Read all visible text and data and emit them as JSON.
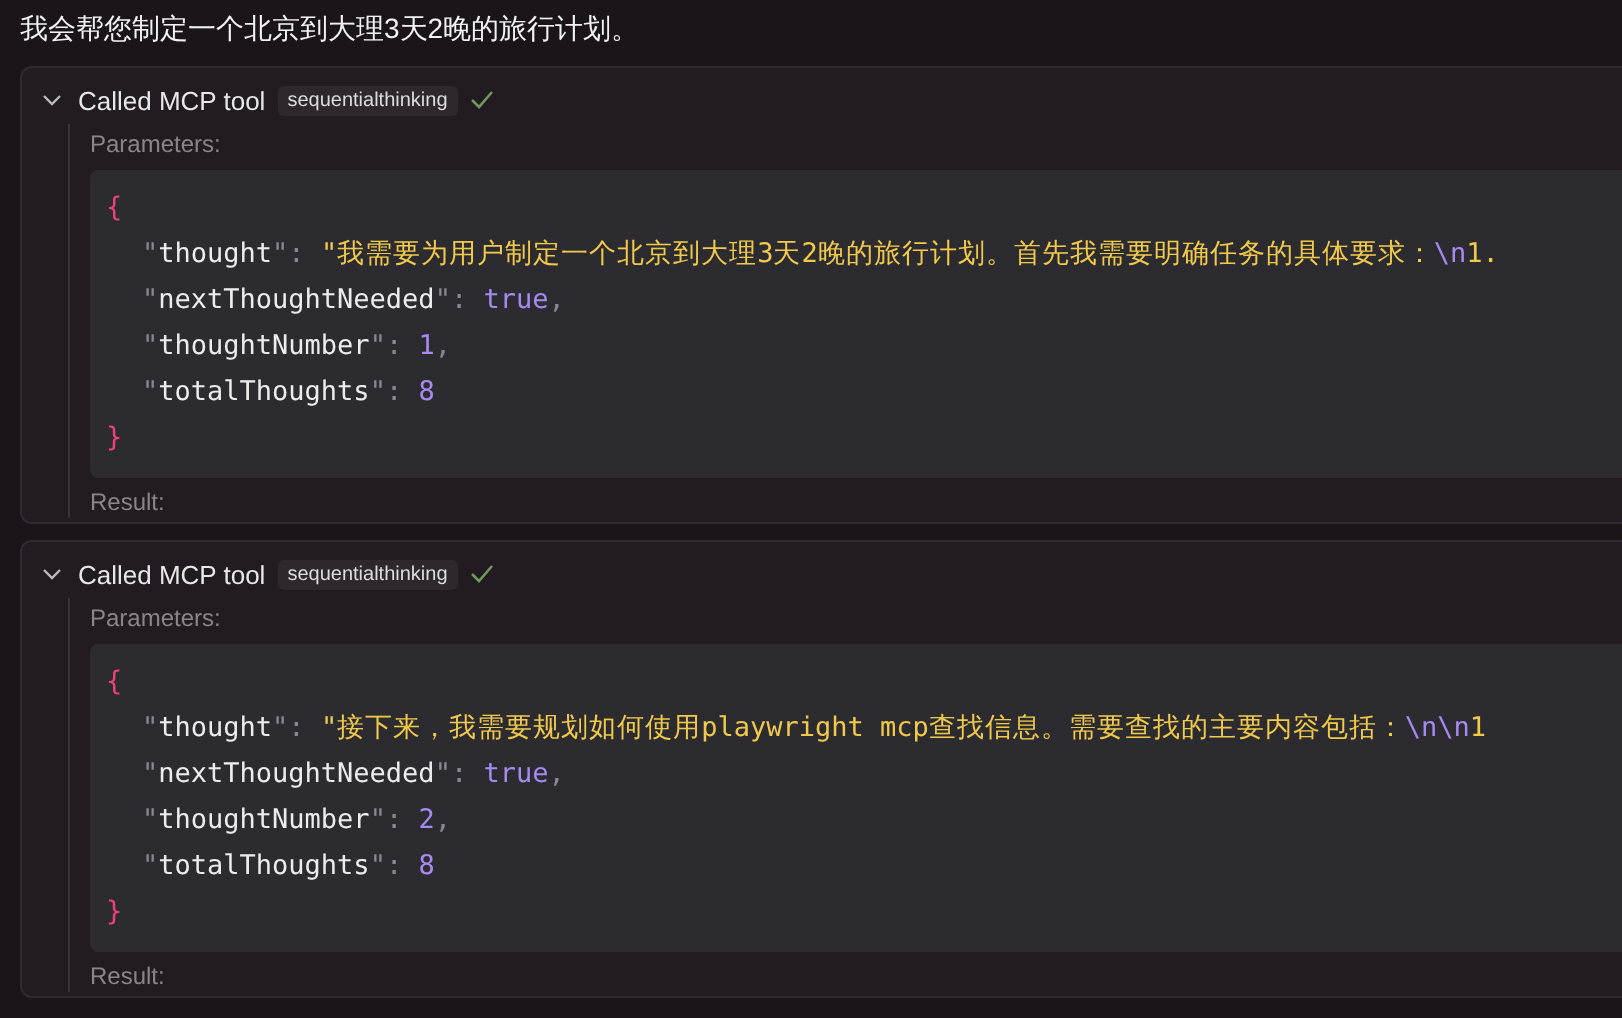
{
  "message": "我会帮您制定一个北京到大理3天2晚的旅行计划。",
  "tool_calls": [
    {
      "expanded": true,
      "label": "Called MCP tool",
      "tool": "sequentialthinking",
      "done": true,
      "params_label": "Parameters:",
      "result_label": "Result:",
      "code": [
        [
          {
            "kind": "brace",
            "text": "{"
          }
        ],
        [
          {
            "kind": "punct",
            "text": "\""
          },
          {
            "kind": "key",
            "text": "thought"
          },
          {
            "kind": "punct",
            "text": "\": "
          },
          {
            "kind": "string",
            "text": "\"我需要为用户制定一个北京到大理3天2晚的旅行计划。首先我需要明确任务的具体要求："
          },
          {
            "kind": "escape",
            "text": "\\n"
          },
          {
            "kind": "string",
            "text": "1."
          }
        ],
        [
          {
            "kind": "punct",
            "text": "\""
          },
          {
            "kind": "key",
            "text": "nextThoughtNeeded"
          },
          {
            "kind": "punct",
            "text": "\": "
          },
          {
            "kind": "literal",
            "text": "true"
          },
          {
            "kind": "punct",
            "text": ","
          }
        ],
        [
          {
            "kind": "punct",
            "text": "\""
          },
          {
            "kind": "key",
            "text": "thoughtNumber"
          },
          {
            "kind": "punct",
            "text": "\": "
          },
          {
            "kind": "literal",
            "text": "1"
          },
          {
            "kind": "punct",
            "text": ","
          }
        ],
        [
          {
            "kind": "punct",
            "text": "\""
          },
          {
            "kind": "key",
            "text": "totalThoughts"
          },
          {
            "kind": "punct",
            "text": "\": "
          },
          {
            "kind": "literal",
            "text": "8"
          }
        ],
        [
          {
            "kind": "brace",
            "text": "}"
          }
        ]
      ]
    },
    {
      "expanded": true,
      "label": "Called MCP tool",
      "tool": "sequentialthinking",
      "done": true,
      "params_label": "Parameters:",
      "result_label": "Result:",
      "code": [
        [
          {
            "kind": "brace",
            "text": "{"
          }
        ],
        [
          {
            "kind": "punct",
            "text": "\""
          },
          {
            "kind": "key",
            "text": "thought"
          },
          {
            "kind": "punct",
            "text": "\": "
          },
          {
            "kind": "string",
            "text": "\"接下来，我需要规划如何使用playwright mcp查找信息。需要查找的主要内容包括："
          },
          {
            "kind": "escape",
            "text": "\\n\\n"
          },
          {
            "kind": "string",
            "text": "1"
          }
        ],
        [
          {
            "kind": "punct",
            "text": "\""
          },
          {
            "kind": "key",
            "text": "nextThoughtNeeded"
          },
          {
            "kind": "punct",
            "text": "\": "
          },
          {
            "kind": "literal",
            "text": "true"
          },
          {
            "kind": "punct",
            "text": ","
          }
        ],
        [
          {
            "kind": "punct",
            "text": "\""
          },
          {
            "kind": "key",
            "text": "thoughtNumber"
          },
          {
            "kind": "punct",
            "text": "\": "
          },
          {
            "kind": "literal",
            "text": "2"
          },
          {
            "kind": "punct",
            "text": ","
          }
        ],
        [
          {
            "kind": "punct",
            "text": "\""
          },
          {
            "kind": "key",
            "text": "totalThoughts"
          },
          {
            "kind": "punct",
            "text": "\": "
          },
          {
            "kind": "literal",
            "text": "8"
          }
        ],
        [
          {
            "kind": "brace",
            "text": "}"
          }
        ]
      ]
    }
  ]
}
